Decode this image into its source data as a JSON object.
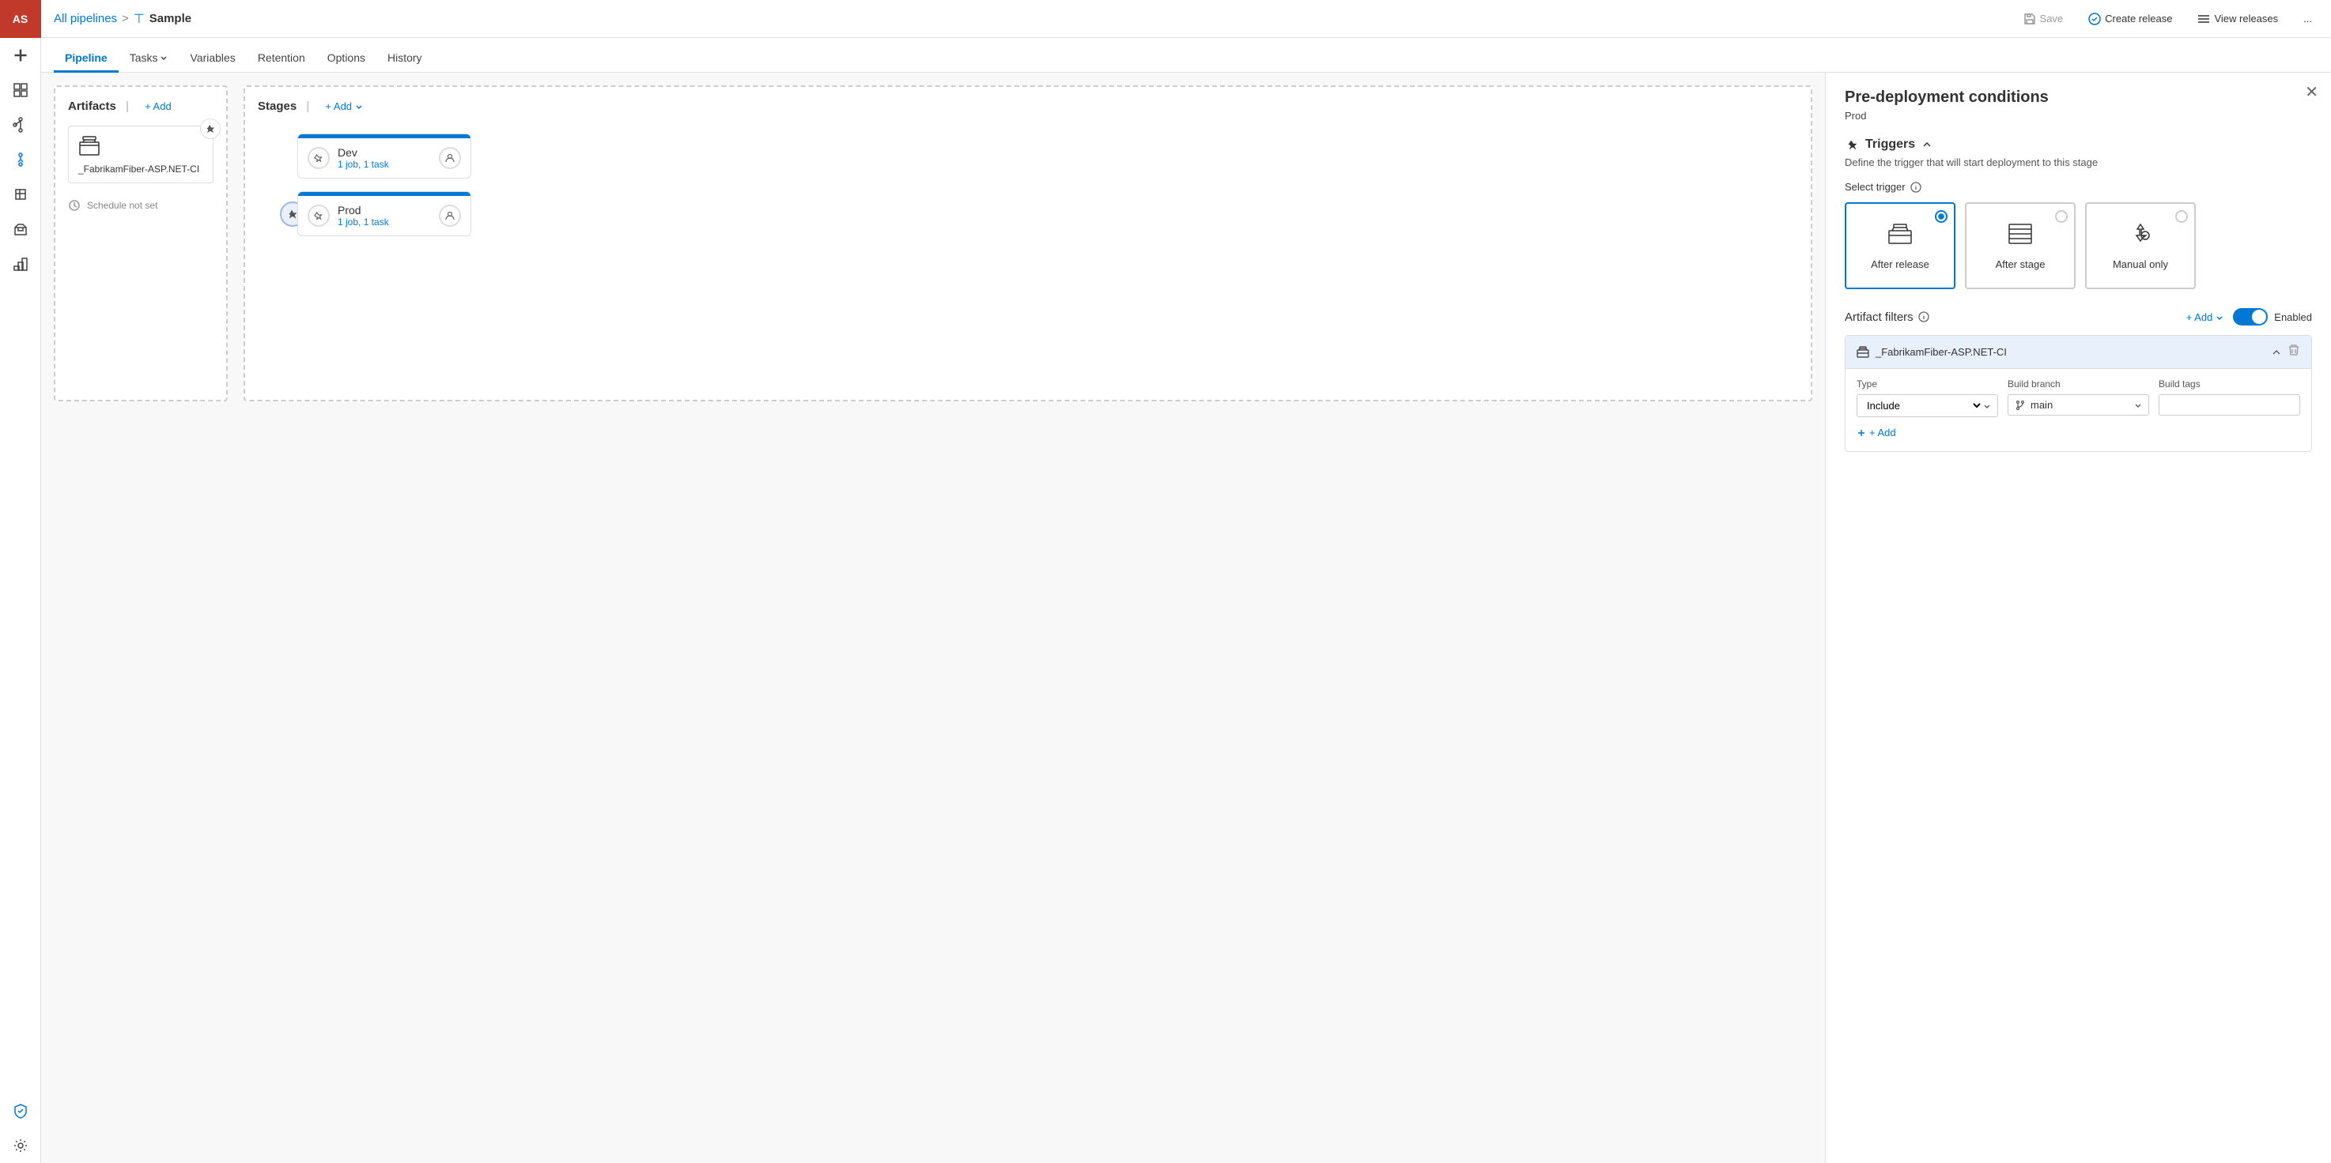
{
  "sidebar": {
    "avatar": "AS",
    "icons": [
      {
        "name": "add-icon",
        "symbol": "+"
      },
      {
        "name": "boards-icon",
        "symbol": "▦"
      },
      {
        "name": "repos-icon",
        "symbol": "⑂"
      },
      {
        "name": "pipelines-icon",
        "symbol": "🚀"
      },
      {
        "name": "testplans-icon",
        "symbol": "🧪"
      },
      {
        "name": "artifacts-icon",
        "symbol": "📦"
      },
      {
        "name": "deploy-icon",
        "symbol": "⊞"
      },
      {
        "name": "shield-icon",
        "symbol": "🛡"
      },
      {
        "name": "settings-icon",
        "symbol": "⚙"
      }
    ]
  },
  "topbar": {
    "breadcrumb_link": "All pipelines",
    "separator": ">",
    "pipeline_icon": "⊤",
    "title": "Sample",
    "save_label": "Save",
    "create_release_label": "Create release",
    "view_releases_label": "View releases",
    "more_label": "..."
  },
  "navtabs": {
    "tabs": [
      {
        "id": "pipeline",
        "label": "Pipeline",
        "active": true,
        "dropdown": false
      },
      {
        "id": "tasks",
        "label": "Tasks",
        "active": false,
        "dropdown": true
      },
      {
        "id": "variables",
        "label": "Variables",
        "active": false,
        "dropdown": false
      },
      {
        "id": "retention",
        "label": "Retention",
        "active": false,
        "dropdown": false
      },
      {
        "id": "options",
        "label": "Options",
        "active": false,
        "dropdown": false
      },
      {
        "id": "history",
        "label": "History",
        "active": false,
        "dropdown": false
      }
    ]
  },
  "canvas": {
    "artifacts_title": "Artifacts",
    "add_label": "+ Add",
    "stages_title": "Stages",
    "stages_add_label": "+ Add",
    "artifact_name": "_FabrikamFiber-ASP.NET-CI",
    "schedule_label": "Schedule not set",
    "stage_dev": {
      "name": "Dev",
      "tasks": "1 job, 1 task"
    },
    "stage_prod": {
      "name": "Prod",
      "tasks": "1 job, 1 task"
    }
  },
  "right_panel": {
    "title": "Pre-deployment conditions",
    "subtitle": "Prod",
    "triggers_section": "Triggers",
    "triggers_desc": "Define the trigger that will start deployment to this stage",
    "select_trigger_label": "Select trigger",
    "trigger_options": [
      {
        "id": "after_release",
        "label": "After release",
        "selected": true
      },
      {
        "id": "after_stage",
        "label": "After stage",
        "selected": false
      },
      {
        "id": "manual_only",
        "label": "Manual only",
        "selected": false
      }
    ],
    "artifact_filters_label": "Artifact filters",
    "add_filter_label": "+ Add",
    "enabled_label": "Enabled",
    "filter_section": {
      "name": "_FabrikamFiber-ASP.NET-CI",
      "type_label": "Type",
      "branch_label": "Build branch",
      "tags_label": "Build tags",
      "type_value": "Include",
      "branch_value": "main",
      "tags_placeholder": ""
    },
    "add_artifact_filter_label": "+ Add"
  }
}
